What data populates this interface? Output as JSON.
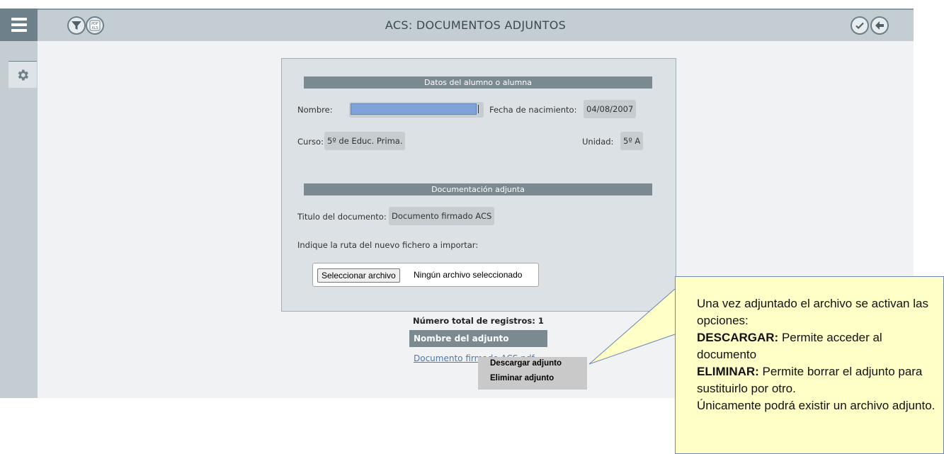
{
  "header": {
    "title": "ACS: DOCUMENTOS ADJUNTOS",
    "pdf_badge_text": "PDF XLS"
  },
  "form": {
    "student_section_title": "Datos del alumno o alumna",
    "name_label": "Nombre:",
    "birth_label": "Fecha de nacimiento:",
    "birth_value": "04/08/2007",
    "course_label": "Curso:",
    "course_value": "5º de Educ. Prima.",
    "unit_label": "Unidad:",
    "unit_value": "5º A",
    "docs_section_title": "Documentación adjunta",
    "doc_title_label": "Titulo del documento:",
    "doc_title_value": "Documento firmado ACS",
    "path_prompt": "Indique la ruta del nuevo fichero a importar:",
    "file_button_label": "Seleccionar archivo",
    "file_status": "Ningún archivo seleccionado"
  },
  "records": {
    "total_label": "Número total de registros: 1",
    "column_header": "Nombre del adjunto",
    "rows": [
      "Documento firmado ACS.pdf"
    ]
  },
  "context_menu": {
    "items": [
      "Descargar adjunto",
      "Eliminar adjunto"
    ]
  },
  "callout": {
    "intro": "Una vez adjuntado el archivo se activan las opciones:",
    "download_key": "DESCARGAR:",
    "download_text": " Permite acceder al documento",
    "delete_key": "ELIMINAR:",
    "delete_text": " Permite borrar el adjunto para sustituirlo por otro.",
    "note": " Únicamente podrá existir un archivo adjunto."
  },
  "colors": {
    "header_bg": "#c3cdd2",
    "menu_btn": "#6e818a",
    "section_bar": "#7b8a91",
    "callout_bg": "#ffffc8"
  },
  "icons": {
    "menu": "hamburger-icon",
    "settings": "gear-icon",
    "filter": "filter-icon",
    "export": "pdf-xls-icon",
    "confirm": "check-icon",
    "back": "arrow-left-icon"
  }
}
